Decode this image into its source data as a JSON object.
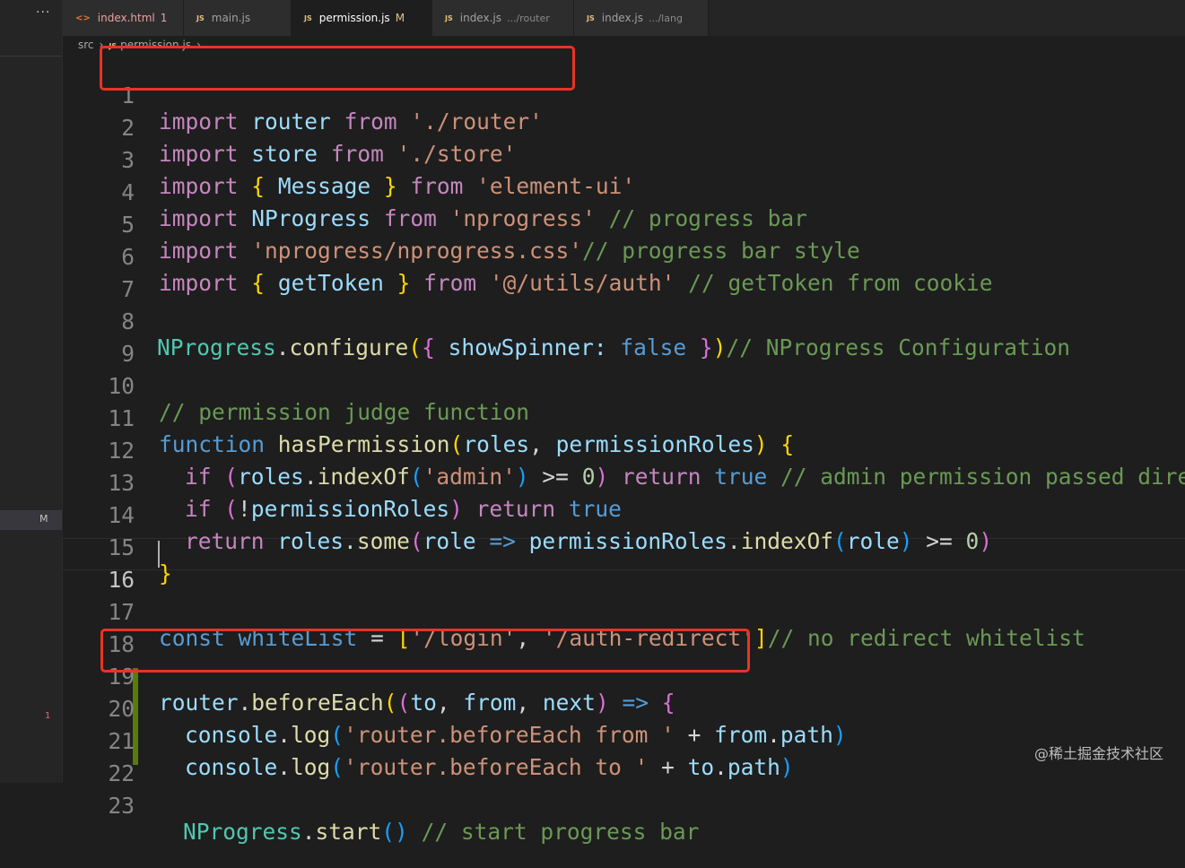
{
  "sidebar": {
    "more": "···",
    "modified": "M",
    "problems": "1"
  },
  "tabs": [
    {
      "icon": "<>",
      "name": "index.html",
      "badge": "1",
      "sub": ""
    },
    {
      "icon": "JS",
      "name": "main.js",
      "badge": "",
      "sub": ""
    },
    {
      "icon": "JS",
      "name": "permission.js",
      "badge": "M",
      "sub": ""
    },
    {
      "icon": "JS",
      "name": "index.js",
      "badge": "",
      "sub": ".../router"
    },
    {
      "icon": "JS",
      "name": "index.js",
      "badge": "",
      "sub": ".../lang"
    }
  ],
  "breadcrumb": {
    "folder": "src",
    "file_icon": "JS",
    "file": "permission.js"
  },
  "editor": {
    "line_numbers": [
      "1",
      "2",
      "3",
      "4",
      "5",
      "6",
      "7",
      "8",
      "9",
      "10",
      "11",
      "12",
      "13",
      "14",
      "15",
      "16",
      "17",
      "18",
      "19",
      "20",
      "21",
      "22",
      "23"
    ],
    "line1": {
      "kw": "import",
      "id": "router",
      "from": "from",
      "str": "'./router'"
    },
    "line2": {
      "kw": "import",
      "id": "store",
      "from": "from",
      "str": "'./store'"
    },
    "line3": {
      "kw": "import",
      "open": "{",
      "id": "Message",
      "close": "}",
      "from": "from",
      "str": "'element-ui'"
    },
    "line4": {
      "kw": "import",
      "id": "NProgress",
      "from": "from",
      "str": "'nprogress'",
      "comment": "// progress bar"
    },
    "line5": {
      "kw": "import",
      "str": "'nprogress/nprogress.css'",
      "comment": "// progress bar style"
    },
    "line6": {
      "kw": "import",
      "open": "{",
      "id": "getToken",
      "close": "}",
      "from": "from",
      "str": "'@/utils/auth'",
      "comment": "// getToken from cookie"
    },
    "line8": {
      "obj": "NProgress",
      "dot": ".",
      "fn": "configure",
      "p_open": "(",
      "b_open": "{",
      "key": "showSpinner",
      "colon": ":",
      "val": "false",
      "b_close": "}",
      "p_close": ")",
      "comment": "// NProgress Configuration"
    },
    "line10": {
      "comment": "// permission judge function"
    },
    "line11": {
      "kw": "function",
      "fn": "hasPermission",
      "p_open": "(",
      "a1": "roles",
      "comma": ",",
      "a2": "permissionRoles",
      "p_close": ")",
      "b_open": "{"
    },
    "line12": {
      "kw": "if",
      "p_open": "(",
      "obj": "roles",
      "dot": ".",
      "fn": "indexOf",
      "p2_open": "(",
      "str": "'admin'",
      "p2_close": ")",
      "op": ">=",
      "num": "0",
      "p_close": ")",
      "ret": "return",
      "val": "true",
      "comment": "// admin permission passed direct"
    },
    "line13": {
      "kw": "if",
      "p_open": "(",
      "bang": "!",
      "id": "permissionRoles",
      "p_close": ")",
      "ret": "return",
      "val": "true"
    },
    "line14": {
      "ret": "return",
      "obj": "roles",
      "dot": ".",
      "fn": "some",
      "p_open": "(",
      "arg": "role",
      "arrow": "=>",
      "obj2": "permissionRoles",
      "dot2": ".",
      "fn2": "indexOf",
      "p2_open": "(",
      "arg2": "role",
      "p2_close": ")",
      "op": ">=",
      "num": "0",
      "p_close": ")"
    },
    "line15": {
      "b_close": "}"
    },
    "line17": {
      "kw": "const",
      "id": "whiteList",
      "eq": "=",
      "br_open": "[",
      "s1": "'/login'",
      "comma": ",",
      "s2": "'/auth-redirect'",
      "br_close": "]",
      "comment": "// no redirect whitelist"
    },
    "line19": {
      "obj": "router",
      "dot": ".",
      "fn": "beforeEach",
      "p_open": "(",
      "p2_open": "(",
      "a1": "to",
      "c1": ",",
      "a2": "from",
      "c2": ",",
      "a3": "next",
      "p2_close": ")",
      "arrow": "=>",
      "b_open": "{"
    },
    "line20": {
      "obj": "console",
      "dot": ".",
      "fn": "log",
      "p_open": "(",
      "str": "'router.beforeEach from '",
      "plus": "+",
      "obj2": "from",
      "dot2": ".",
      "prop": "path",
      "p_close": ")"
    },
    "line21": {
      "obj": "console",
      "dot": ".",
      "fn": "log",
      "p_open": "(",
      "str": "'router.beforeEach to '",
      "plus": "+",
      "obj2": "to",
      "dot2": ".",
      "prop": "path",
      "p_close": ")"
    },
    "line23": {
      "obj": "NProgress",
      "dot": ".",
      "fn": "start",
      "parens": "()",
      "comment": "// start progress bar"
    }
  },
  "watermark": "@稀土掘金技术社区",
  "colors": {
    "highlight_box": "#ea3323",
    "editor_bg": "#1e1e1e",
    "git_added": "#587c0c"
  }
}
